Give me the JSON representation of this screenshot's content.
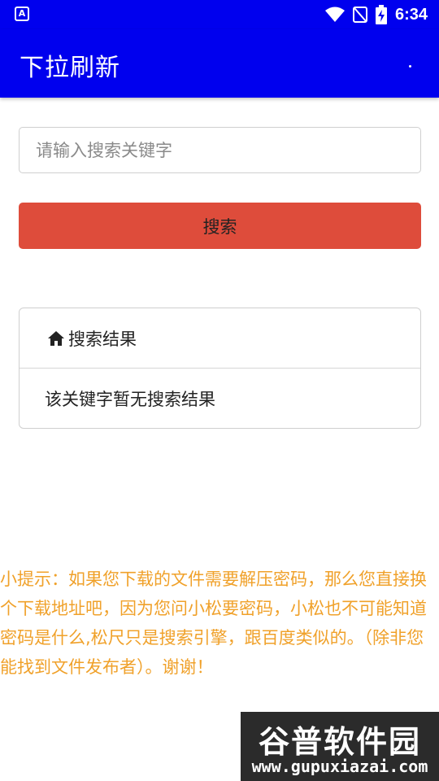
{
  "status_bar": {
    "time": "6:34",
    "left_icon": "A",
    "icons": [
      "wifi-icon",
      "signal-off-icon",
      "battery-charging-icon"
    ]
  },
  "app_bar": {
    "title": "下拉刷新",
    "background": "#0000ee"
  },
  "search": {
    "placeholder": "请输入搜索关键字",
    "value": "",
    "button_label": "搜索",
    "button_color": "#de4c3b"
  },
  "results": {
    "header_icon": "home-icon",
    "header_label": "搜索结果",
    "empty_message": "该关键字暂无搜索结果"
  },
  "tip": {
    "text": "小提示：如果您下载的文件需要解压密码，那么您直接换个下载地址吧，因为您问小松要密码，小松也不可能知道密码是什么,松尺只是搜索引擎，跟百度类似的。（除非您能找到文件发布者）。谢谢！",
    "color": "#f0a12a"
  },
  "watermark": {
    "logo_text": "谷普软件园",
    "url": "www.gupuxiazai.com"
  }
}
